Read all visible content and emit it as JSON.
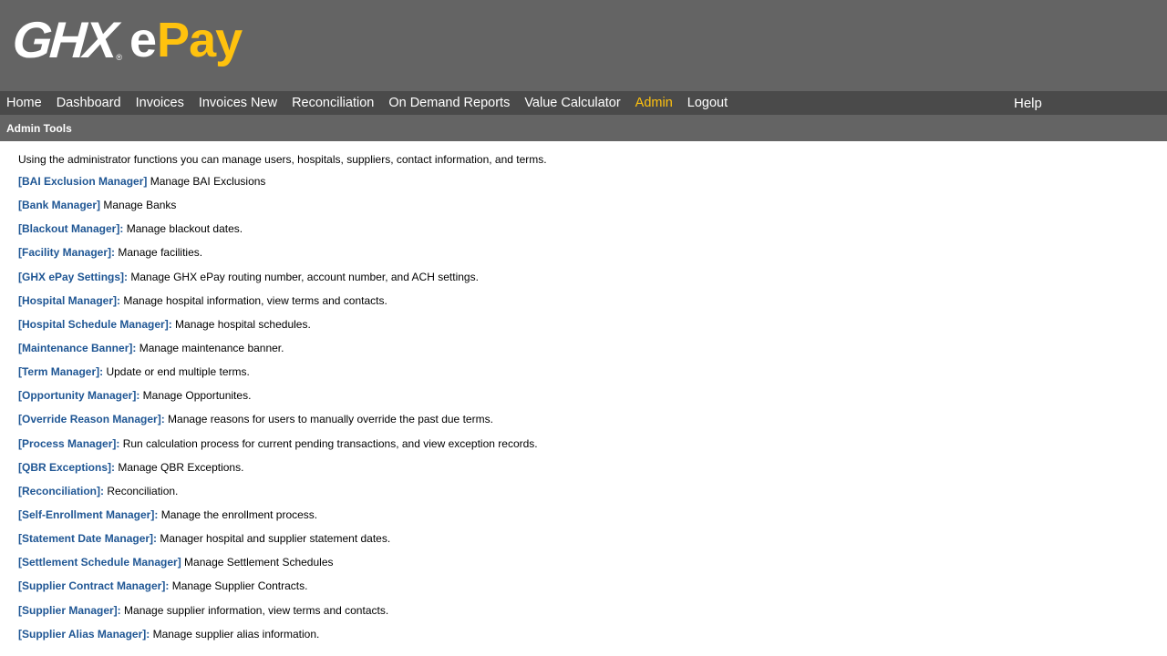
{
  "brand": {
    "ghx": "GHX",
    "registered": "®",
    "e": "e",
    "pay": "Pay",
    "accent_color": "#ffc20e"
  },
  "nav": {
    "items": [
      {
        "label": "Home"
      },
      {
        "label": "Dashboard"
      },
      {
        "label": "Invoices"
      },
      {
        "label": "Invoices New"
      },
      {
        "label": "Reconciliation"
      },
      {
        "label": "On Demand Reports"
      },
      {
        "label": "Value Calculator"
      },
      {
        "label": "Admin",
        "active": true
      },
      {
        "label": "Logout"
      }
    ],
    "help": "Help"
  },
  "subbar": {
    "title": "Admin Tools"
  },
  "intro": "Using the administrator functions you can manage users, hospitals, suppliers, contact information, and terms.",
  "link_color": "#1f5694",
  "tools": [
    {
      "link": "[BAI Exclusion Manager]",
      "desc": " Manage BAI Exclusions"
    },
    {
      "link": "[Bank Manager]",
      "desc": " Manage Banks"
    },
    {
      "link": "[Blackout Manager]:",
      "desc": " Manage blackout dates."
    },
    {
      "link": "[Facility Manager]:",
      "desc": " Manage facilities."
    },
    {
      "link": "[GHX ePay Settings]:",
      "desc": " Manage GHX ePay routing number, account number, and ACH settings."
    },
    {
      "link": "[Hospital Manager]:",
      "desc": " Manage hospital information, view terms and contacts."
    },
    {
      "link": "[Hospital Schedule Manager]:",
      "desc": " Manage hospital schedules."
    },
    {
      "link": "[Maintenance Banner]:",
      "desc": " Manage maintenance banner."
    },
    {
      "link": "[Term Manager]:",
      "desc": " Update or end multiple terms."
    },
    {
      "link": "[Opportunity Manager]:",
      "desc": " Manage Opportunites."
    },
    {
      "link": "[Override Reason Manager]:",
      "desc": " Manage reasons for users to manually override the past due terms."
    },
    {
      "link": "[Process Manager]:",
      "desc": " Run calculation process for current pending transactions, and view exception records."
    },
    {
      "link": "[QBR Exceptions]:",
      "desc": " Manage QBR Exceptions."
    },
    {
      "link": "[Reconciliation]:",
      "desc": " Reconciliation."
    },
    {
      "link": "[Self-Enrollment Manager]:",
      "desc": " Manage the enrollment process."
    },
    {
      "link": "[Statement Date Manager]:",
      "desc": " Manager hospital and supplier statement dates."
    },
    {
      "link": "[Settlement Schedule Manager]",
      "desc": " Manage Settlement Schedules"
    },
    {
      "link": "[Supplier Contract Manager]:",
      "desc": " Manage Supplier Contracts."
    },
    {
      "link": "[Supplier Manager]:",
      "desc": " Manage supplier information, view terms and contacts."
    },
    {
      "link": "[Supplier Alias Manager]:",
      "desc": " Manage supplier alias information."
    }
  ]
}
